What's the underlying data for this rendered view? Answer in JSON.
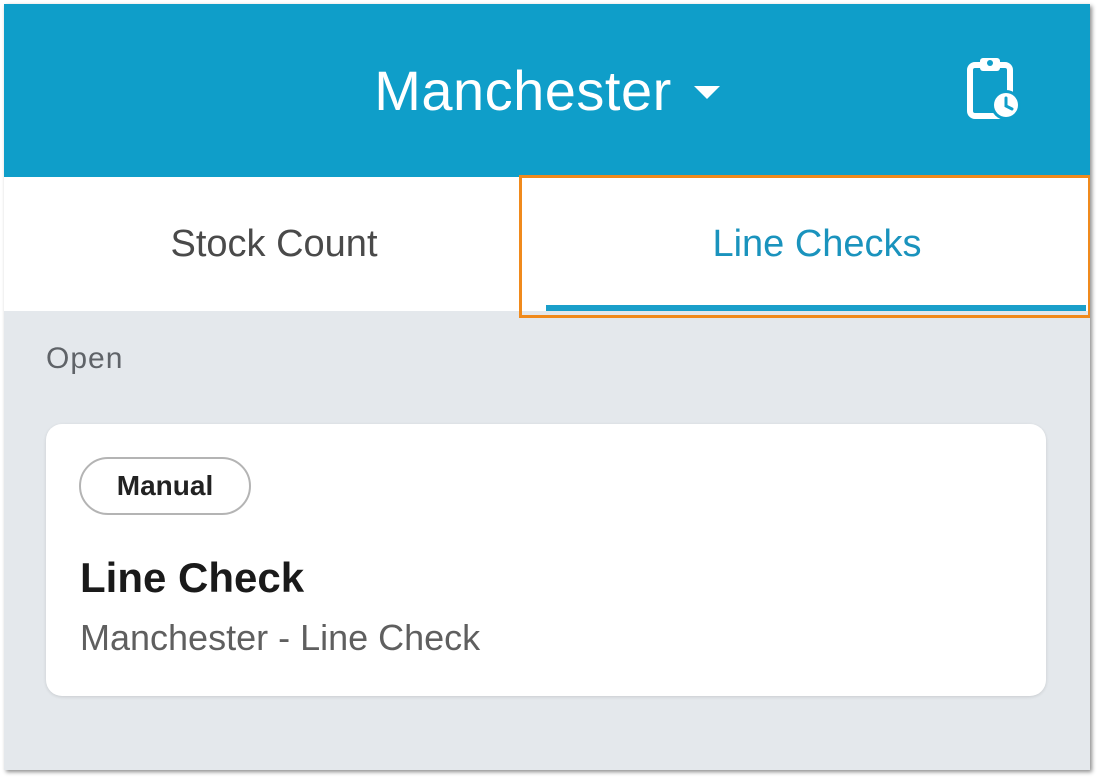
{
  "header": {
    "location": "Manchester",
    "location_icon": "chevron-down-icon",
    "action_icon": "clipboard-clock-icon",
    "background_color": "#0f9ec9"
  },
  "tabs": [
    {
      "label": "Stock Count",
      "selected": false
    },
    {
      "label": "Line Checks",
      "selected": true
    }
  ],
  "accent_color": "#1a93bd",
  "highlight_color": "#f08a1c",
  "section": {
    "label": "Open",
    "cards": [
      {
        "badge": "Manual",
        "title": "Line Check",
        "subtitle": "Manchester - Line Check"
      }
    ]
  }
}
